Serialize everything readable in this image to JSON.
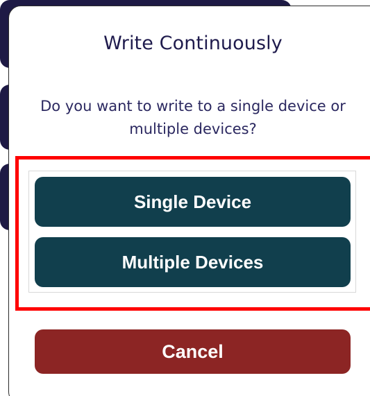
{
  "dialog": {
    "title": "Write Continuously",
    "message": "Do you want to write to a single device or multiple devices?",
    "buttons": {
      "single": "Single Device",
      "multiple": "Multiple Devices",
      "cancel": "Cancel"
    }
  },
  "colors": {
    "primary_button": "#113f4d",
    "cancel_button": "#8c2524",
    "title_text": "#1f1b4d",
    "highlight": "#ff0000"
  }
}
